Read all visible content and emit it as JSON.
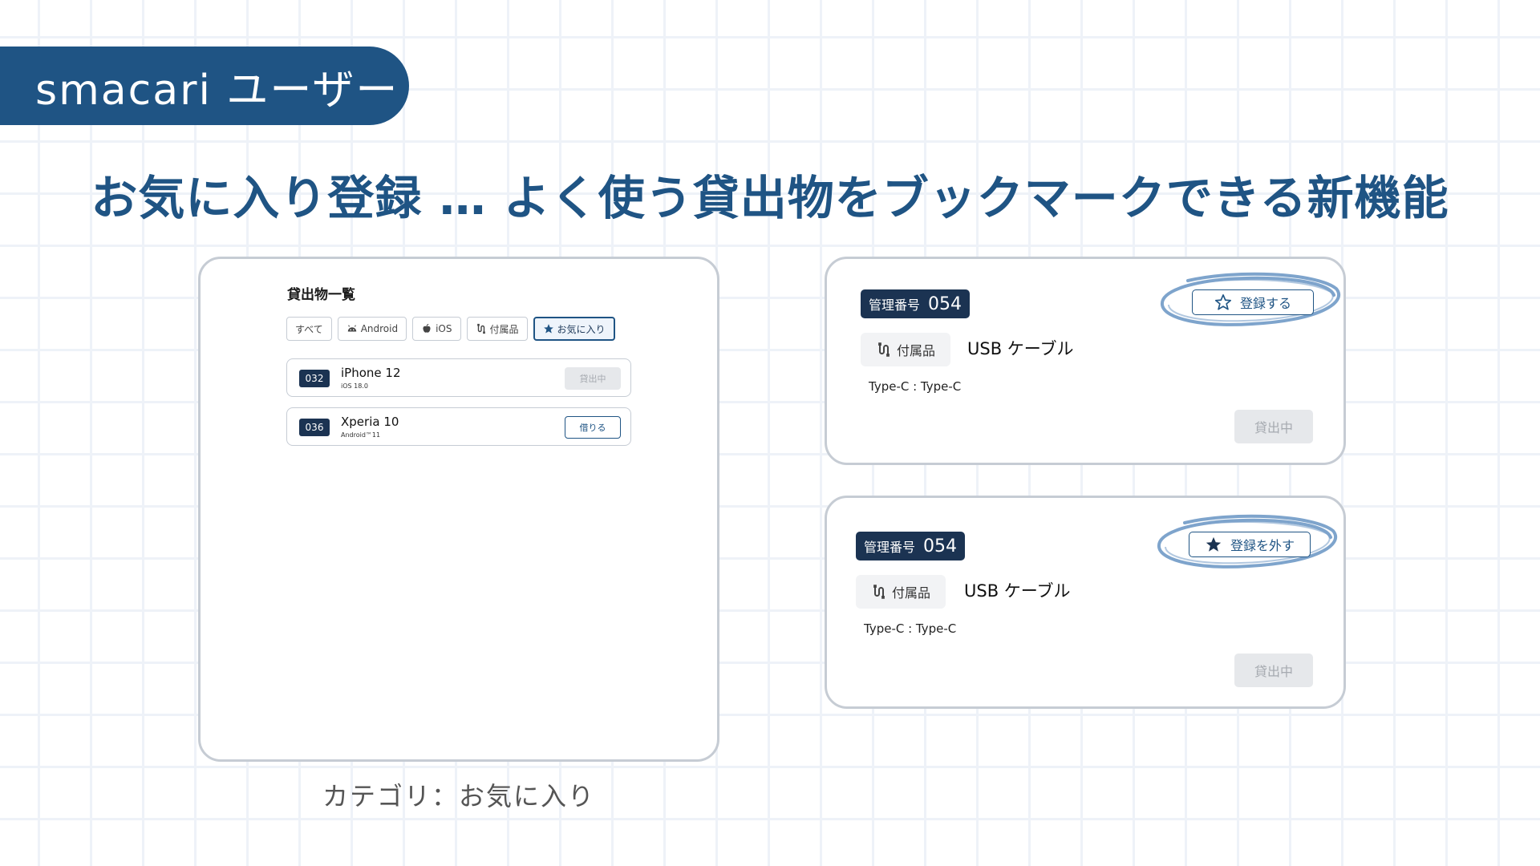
{
  "badge": {
    "text": "smacari ユーザー"
  },
  "headline": "お気に入り登録 … よく使う貸出物をブックマークできる新機能",
  "left_panel": {
    "title": "貸出物一覧",
    "tabs": [
      {
        "label": "すべて",
        "icon": ""
      },
      {
        "label": "Android",
        "icon": "android-icon"
      },
      {
        "label": "iOS",
        "icon": "apple-icon"
      },
      {
        "label": "付属品",
        "icon": "cable-icon"
      },
      {
        "label": "お気に入り",
        "icon": "star-filled-icon",
        "active": true
      }
    ],
    "rows": [
      {
        "id": "032",
        "name": "iPhone 12",
        "sub": "iOS 18.0",
        "action": "貸出中",
        "action_state": "disabled"
      },
      {
        "id": "036",
        "name": "Xperia 10",
        "sub": "Android™11",
        "action": "借りる",
        "action_state": "primary"
      }
    ]
  },
  "caption": "カテゴリ：お気に入り",
  "card_top": {
    "mgmt_label": "管理番号",
    "mgmt_number": "054",
    "category": "付属品",
    "name": "USB ケーブル",
    "spec": "Type-C : Type-C",
    "status": "貸出中",
    "fav_label": "登録する",
    "fav_icon": "star-outline-icon"
  },
  "card_bottom": {
    "mgmt_label": "管理番号",
    "mgmt_number": "054",
    "category": "付属品",
    "name": "USB ケーブル",
    "spec": "Type-C : Type-C",
    "status": "貸出中",
    "fav_label": "登録を外す",
    "fav_icon": "star-filled-icon"
  },
  "colors": {
    "brand": "#1f5484",
    "navy": "#1b3352",
    "border": "#c6ccd4",
    "disabled_bg": "#e6e8eb",
    "scribble": "#7ea4cc"
  }
}
